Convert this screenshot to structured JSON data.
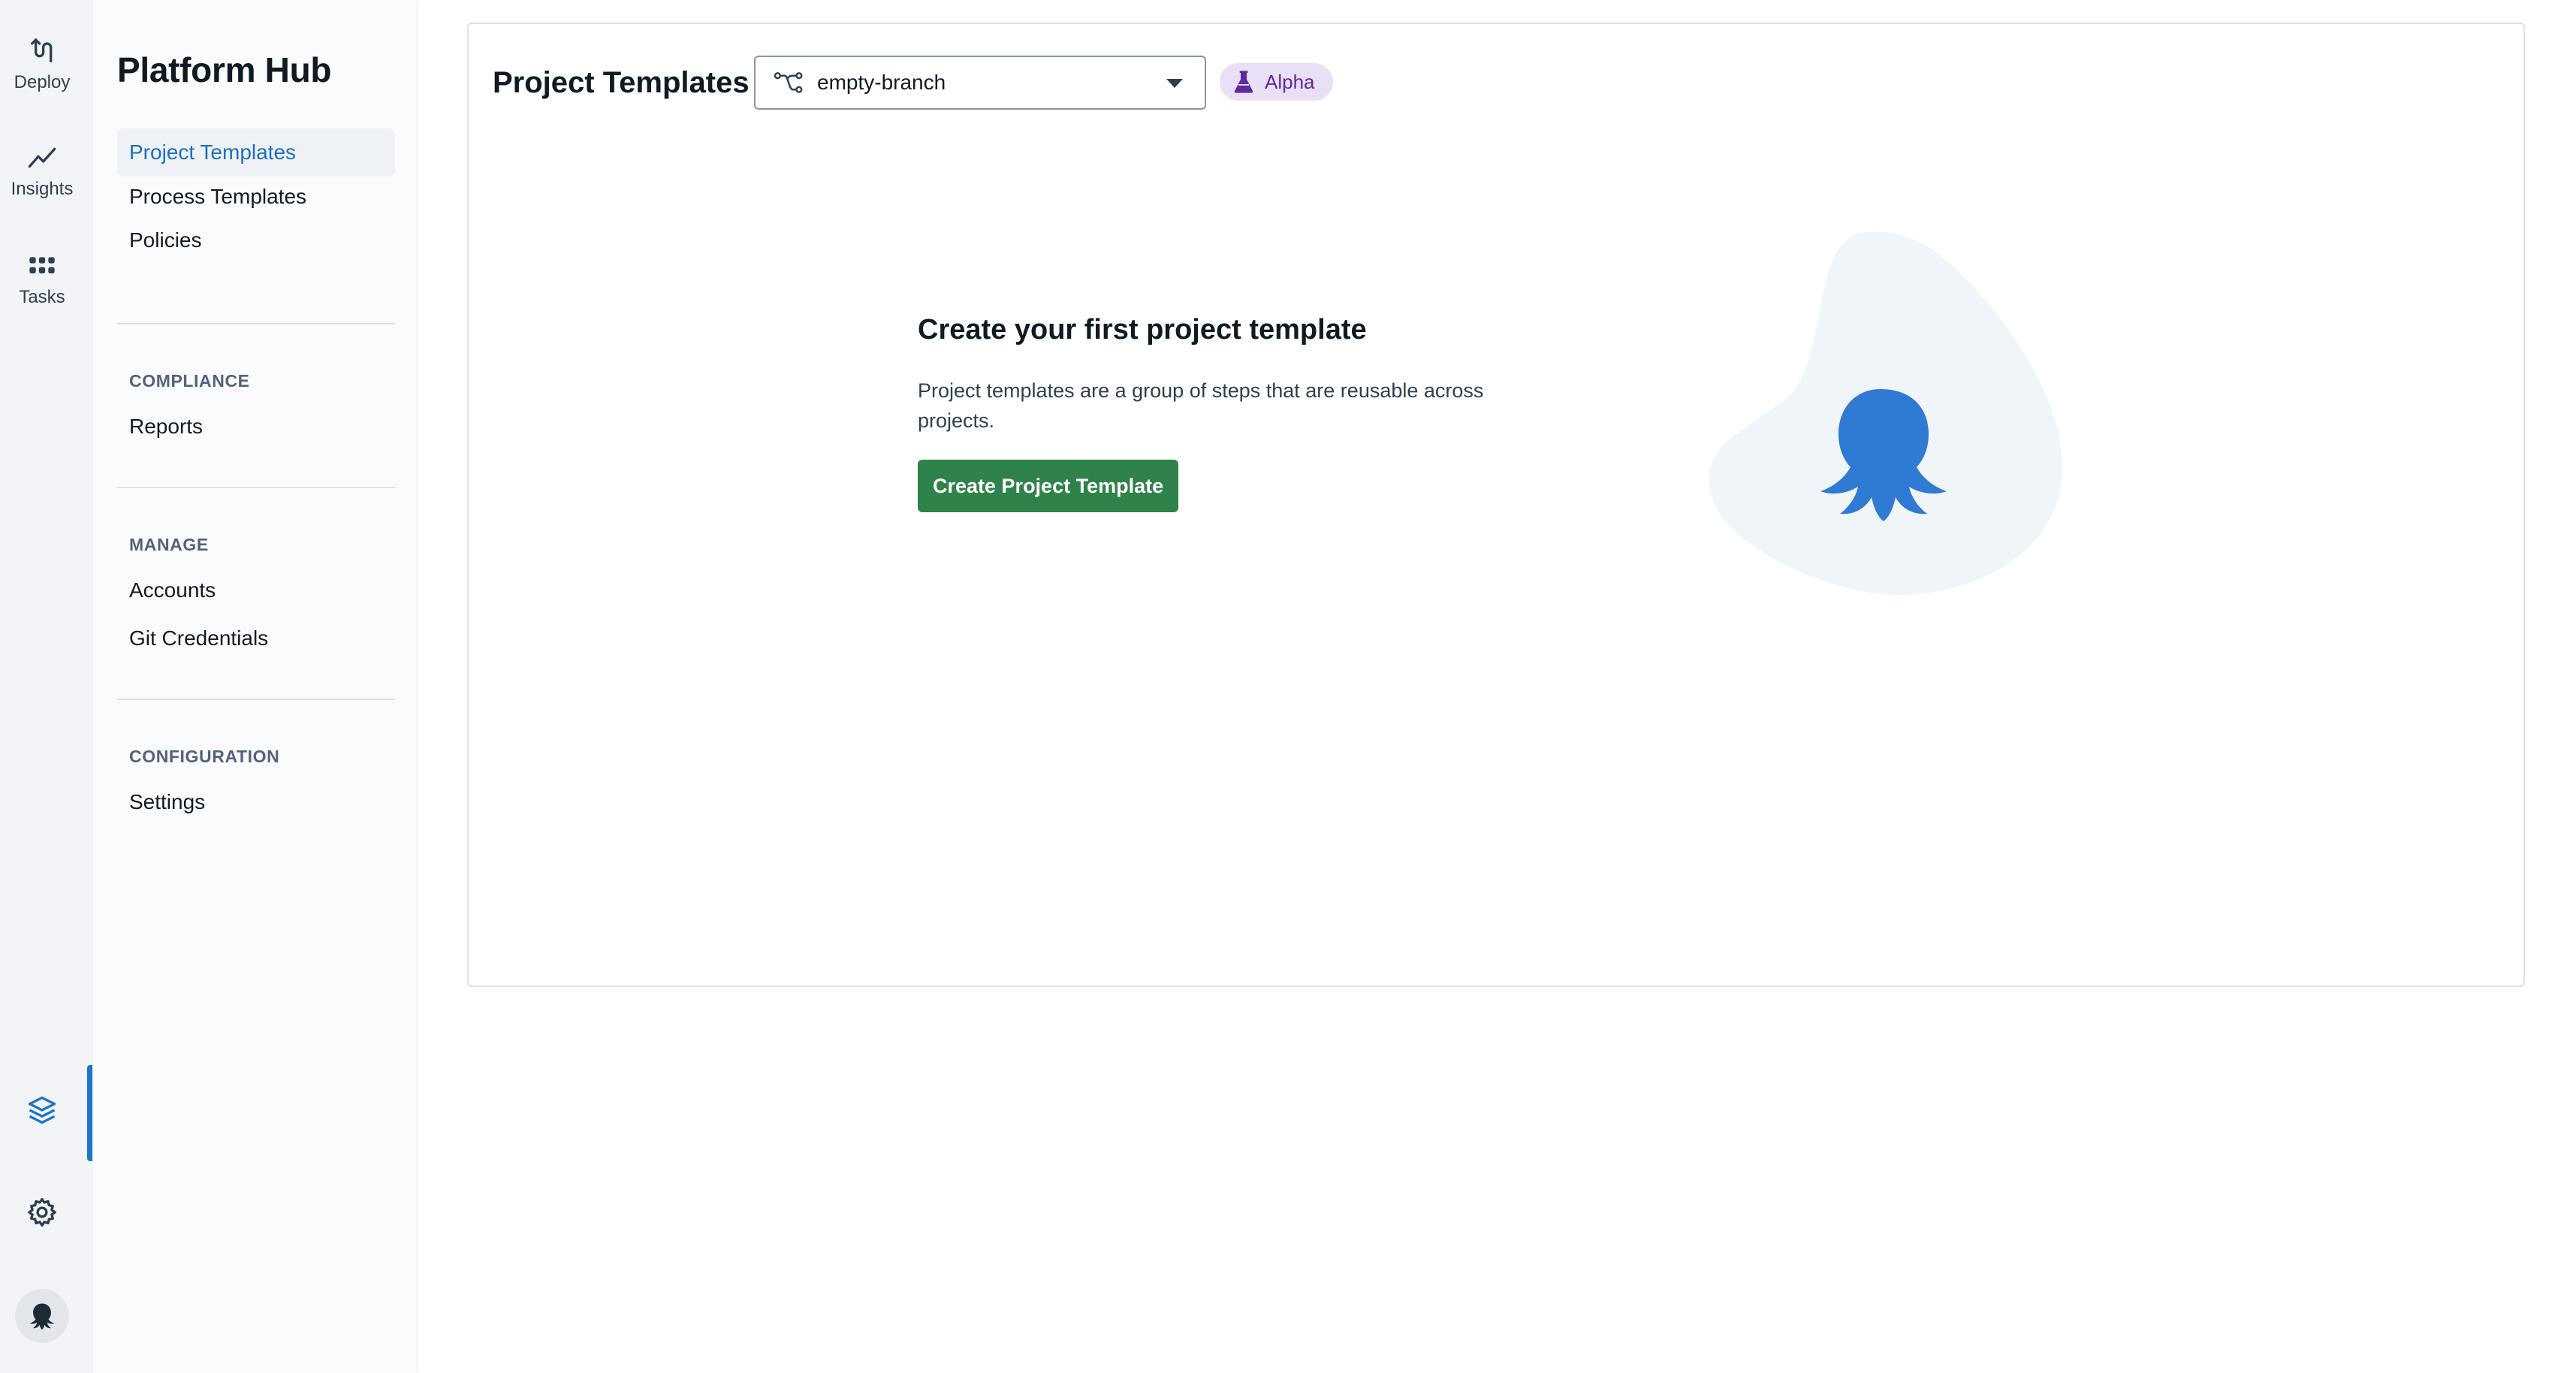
{
  "rail": {
    "items": [
      {
        "label": "Deploy",
        "icon": "deploy-icon"
      },
      {
        "label": "Insights",
        "icon": "insights-chart-icon"
      },
      {
        "label": "Tasks",
        "icon": "tasks-grid-icon"
      }
    ],
    "bottom_icons": [
      "layers-icon",
      "gear-icon",
      "octopus-avatar-icon"
    ],
    "active_accent": "#1a77ca"
  },
  "sidebar": {
    "title": "Platform Hub",
    "main_items": [
      {
        "label": "Project Templates",
        "active": true
      },
      {
        "label": "Process Templates",
        "active": false
      },
      {
        "label": "Policies",
        "active": false
      }
    ],
    "sections": [
      {
        "heading": "COMPLIANCE",
        "items": [
          "Reports"
        ]
      },
      {
        "heading": "MANAGE",
        "items": [
          "Accounts",
          "Git Credentials"
        ]
      },
      {
        "heading": "CONFIGURATION",
        "items": [
          "Settings"
        ]
      }
    ]
  },
  "main": {
    "title": "Project Templates",
    "branch_select": {
      "value": "empty-branch",
      "icon": "git-branch-icon"
    },
    "badge": {
      "label": "Alpha",
      "icon": "flask-icon",
      "color": "#5d2a9e"
    },
    "empty_state": {
      "heading": "Create your first project template",
      "description": "Project templates are a group of steps that are reusable across projects.",
      "button_label": "Create Project Template",
      "button_color": "#2f8249",
      "illustration": "octopus-illustration"
    }
  }
}
